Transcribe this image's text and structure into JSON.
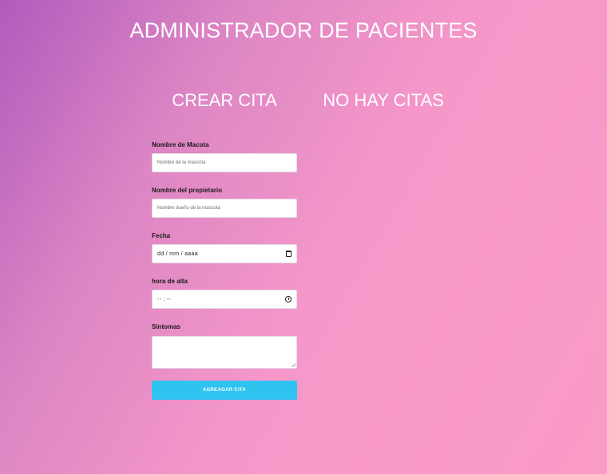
{
  "header": {
    "title": "ADMINISTRADOR DE PACIENTES"
  },
  "form_section": {
    "title": "CREAR CITA",
    "fields": {
      "pet_name": {
        "label": "Nombre de Macota",
        "placeholder": "Nombre de la mascota"
      },
      "owner_name": {
        "label": "Nombre del propietario",
        "placeholder": "Nombre dueño de la mascota"
      },
      "date": {
        "label": "Fecha",
        "value": "dd / mm / aaaa",
        "icon": "calendar-icon"
      },
      "time": {
        "label": "hora de alta",
        "value": "-- : --",
        "icon": "clock-icon"
      },
      "symptoms": {
        "label": "Sintomas",
        "value": ""
      }
    },
    "submit_label": "AGREAGAR CITA",
    "submit_color": "#2ec4ef"
  },
  "list_section": {
    "title": "NO HAY CITAS"
  },
  "colors": {
    "gradient_start": "#b15bbd",
    "gradient_end": "#fa9bc6"
  }
}
